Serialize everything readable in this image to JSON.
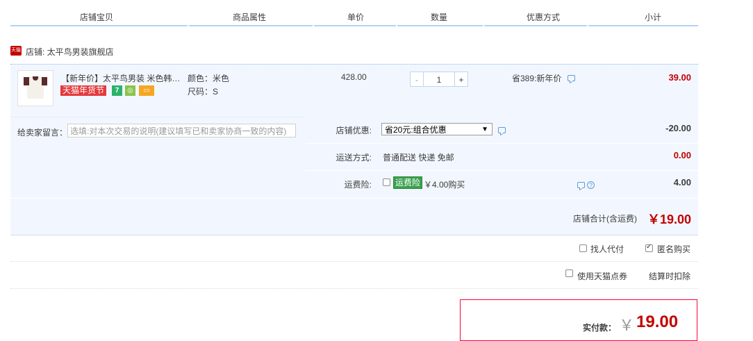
{
  "header": {
    "columns": [
      "店铺宝贝",
      "商品属性",
      "单价",
      "数量",
      "优惠方式",
      "小计"
    ]
  },
  "shop": {
    "badge": "天猫",
    "label": "店铺: 太平鸟男装旗舰店"
  },
  "item": {
    "title": "【新年价】太平鸟男装 米色韩…",
    "promo_badge": "天猫年货节",
    "badge_icons": [
      "seven-day-return-icon",
      "guarantee-icon",
      "card-icon"
    ],
    "color_attr": "颜色：米色",
    "size_attr": "尺码：S",
    "unit_price": "428.00",
    "qty_minus": "-",
    "qty_value": "1",
    "qty_plus": "+",
    "discount": "省389:新年价",
    "subtotal": "39.00"
  },
  "message": {
    "label": "给卖家留言：",
    "placeholder": "选填:对本次交易的说明(建议填写已和卖家协商一致的内容)"
  },
  "options": {
    "shop_discount_label": "店铺优惠:",
    "shop_discount_select": "省20元:组合优惠",
    "shop_discount_value": "-20.00",
    "shipping_label": "运送方式:",
    "shipping_text": "普通配送 快递 免邮",
    "shipping_value": "0.00",
    "insurance_label": "运费险:",
    "insurance_badge": "运费险",
    "insurance_text": "￥4.00购买",
    "insurance_value": "4.00"
  },
  "total": {
    "label": "店铺合计(含运费)",
    "value": "￥19.00"
  },
  "extras": {
    "proxy_pay": "找人代付",
    "anonymous": "匿名购买",
    "tmall_points": "使用天猫点券",
    "points_note": "结算时扣除"
  },
  "pay": {
    "label": "实付款：",
    "currency": "￥",
    "value": "19.00"
  },
  "colors": {
    "accent_red": "#c40000",
    "border_blue": "#b2d1ff",
    "row_bg": "#f2f7ff"
  }
}
